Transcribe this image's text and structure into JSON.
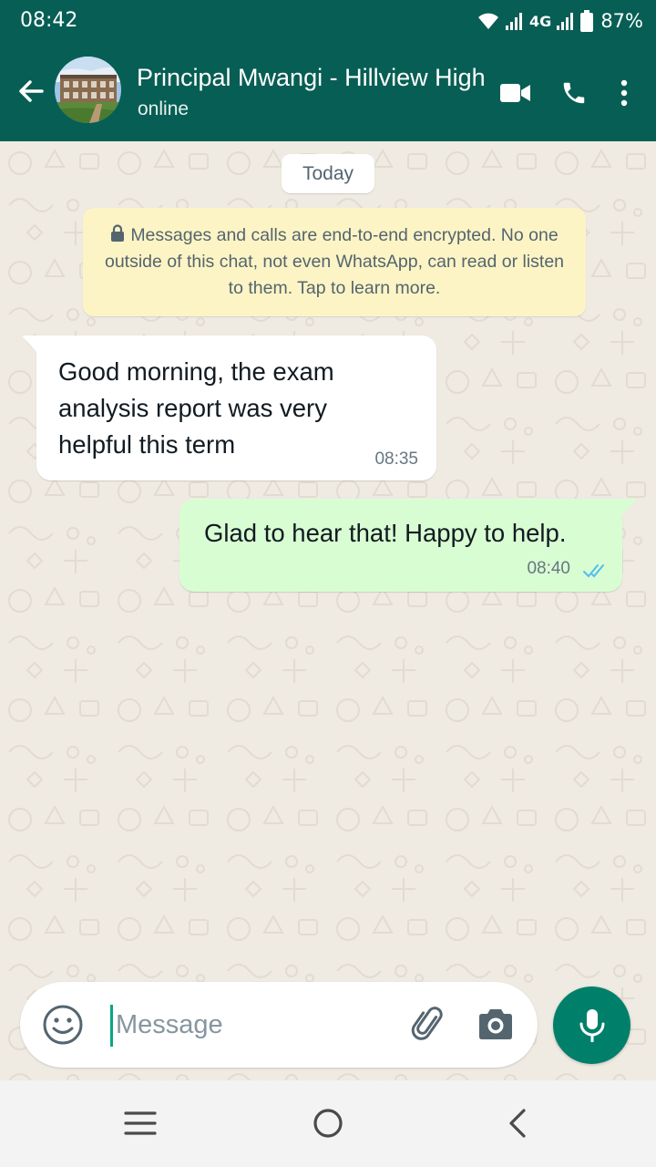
{
  "status_bar": {
    "time": "08:42",
    "network": "4G",
    "battery": "87%"
  },
  "header": {
    "contact_name": "Principal Mwangi - Hillview High",
    "contact_status": "online",
    "icons": [
      "back-arrow-icon",
      "video-call-icon",
      "voice-call-icon",
      "more-options-icon"
    ]
  },
  "chat": {
    "date_label": "Today",
    "encryption_notice": "Messages and calls are end-to-end encrypted. No one outside of this chat, not even WhatsApp, can read or listen to them. Tap to learn more.",
    "messages": [
      {
        "direction": "incoming",
        "text": "Good morning, the exam analysis report was very helpful this term",
        "time": "08:35"
      },
      {
        "direction": "outgoing",
        "text": "Glad to hear that! Happy to help.",
        "time": "08:40",
        "status": "read"
      }
    ]
  },
  "composer": {
    "placeholder": "Message",
    "value": "",
    "icons": [
      "emoji-icon",
      "attach-icon",
      "camera-icon",
      "mic-icon"
    ]
  },
  "nav": {
    "icons": [
      "menu-icon",
      "home-icon",
      "back-icon"
    ]
  },
  "colors": {
    "header": "#075e54",
    "chat_background": "#efeae2",
    "outgoing_bubble": "#d9fdd3",
    "incoming_bubble": "#ffffff",
    "encryption_bubble": "#fdf4c5",
    "accent": "#00a884",
    "mic_button": "#00806a",
    "read_ticks": "#53bdeb"
  }
}
